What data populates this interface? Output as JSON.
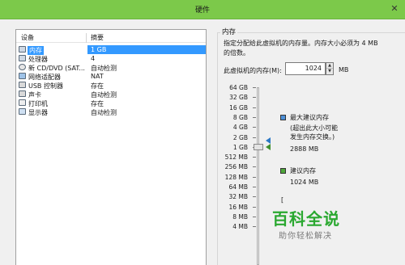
{
  "window": {
    "title": "硬件",
    "close_icon": "close-icon"
  },
  "devices": {
    "col_device": "设备",
    "col_summary": "摘要",
    "rows": [
      {
        "name": "内存",
        "value": "1 GB",
        "icon": "memory-icon"
      },
      {
        "name": "处理器",
        "value": "4",
        "icon": "cpu-icon"
      },
      {
        "name": "新 CD/DVD (SAT...",
        "value": "自动检测",
        "icon": "cd-dvd-icon"
      },
      {
        "name": "网络适配器",
        "value": "NAT",
        "icon": "network-adapter-icon"
      },
      {
        "name": "USB 控制器",
        "value": "存在",
        "icon": "usb-icon"
      },
      {
        "name": "声卡",
        "value": "自动检测",
        "icon": "sound-card-icon"
      },
      {
        "name": "打印机",
        "value": "存在",
        "icon": "printer-icon"
      },
      {
        "name": "显示器",
        "value": "自动检测",
        "icon": "display-icon"
      }
    ]
  },
  "memory": {
    "group_label": "内存",
    "desc_line1": "指定分配给此虚拟机的内存量。内存大小必须为 4 MB",
    "desc_line2": "的倍数。",
    "field_label": "此虚拟机的内存(M):",
    "field_value": "1024",
    "unit": "MB",
    "ticks": [
      "64 GB",
      "32 GB",
      "16 GB",
      "8 GB",
      "4 GB",
      "2 GB",
      "1 GB",
      "512 MB",
      "256 MB",
      "128 MB",
      "64 MB",
      "32 MB",
      "16 MB",
      "8 MB",
      "4 MB"
    ],
    "selected_gb": 1,
    "max_recommended_title": "最大建议内存",
    "max_recommended_note1": "(超出此大小可能",
    "max_recommended_note2": "发生内存交换。)",
    "max_recommended_value": "2888 MB",
    "recommended_title": "建议内存",
    "recommended_value": "1024 MB",
    "guest_min_text": "[",
    "colors": {
      "max_marker": "#2b78c5",
      "rec_marker": "#3f8f2f",
      "guest_marker": "#f3d437"
    }
  },
  "watermark": {
    "title": "百科全说",
    "subtitle": "助你轻松解决"
  }
}
